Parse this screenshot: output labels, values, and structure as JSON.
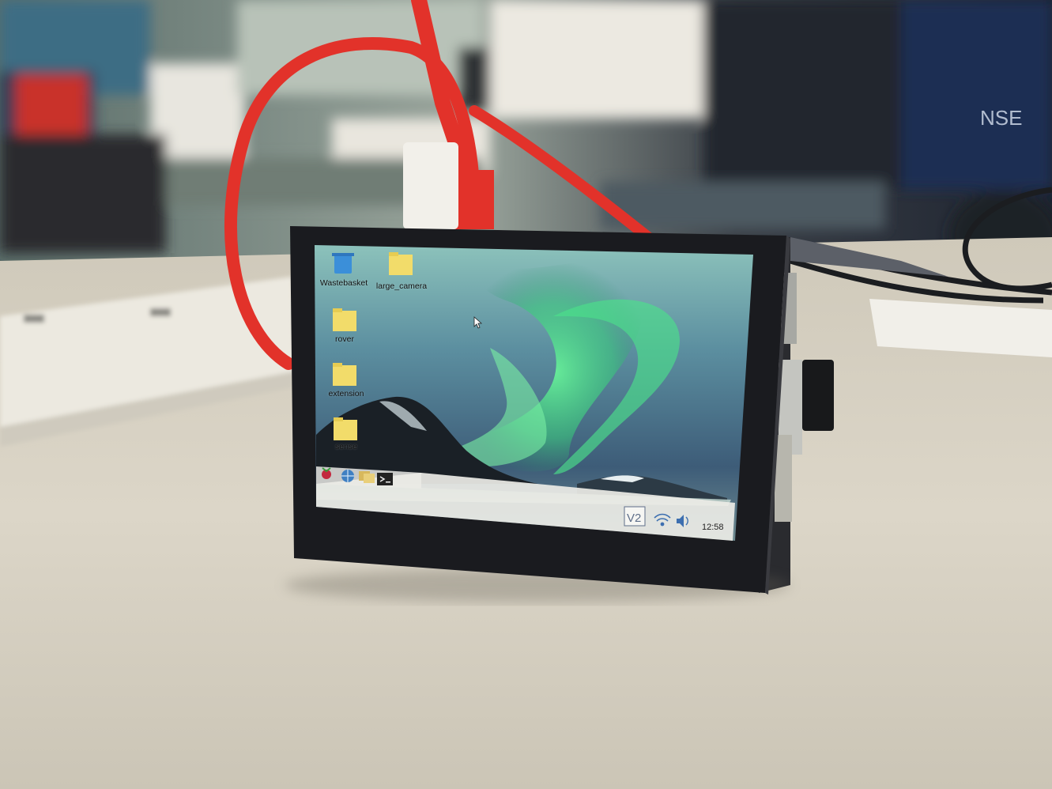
{
  "desktop": {
    "icons": [
      {
        "label": "Wastebasket",
        "icon": "trash-icon"
      },
      {
        "label": "large_camera",
        "icon": "folder-icon"
      },
      {
        "label": "rover",
        "icon": "folder-icon"
      },
      {
        "label": "extension",
        "icon": "folder-icon"
      },
      {
        "label": "sense",
        "icon": "folder-icon"
      }
    ]
  },
  "taskbar": {
    "launchers": [
      "raspberry-menu-icon",
      "web-browser-icon",
      "file-manager-icon",
      "terminal-icon"
    ],
    "tray": {
      "vnc_label": "V2",
      "wifi": "wifi-icon",
      "volume": "volume-icon",
      "clock": "12:58"
    }
  },
  "background_text": {
    "sign": "NSE"
  },
  "colors": {
    "screen_bezel": "#1a1b1f",
    "aurora_green": "#4be08a",
    "sky_top": "#7ab6b0",
    "taskbar": "#e8e8e4",
    "cable_red": "#e2322a",
    "desk": "#d8d2c3"
  }
}
